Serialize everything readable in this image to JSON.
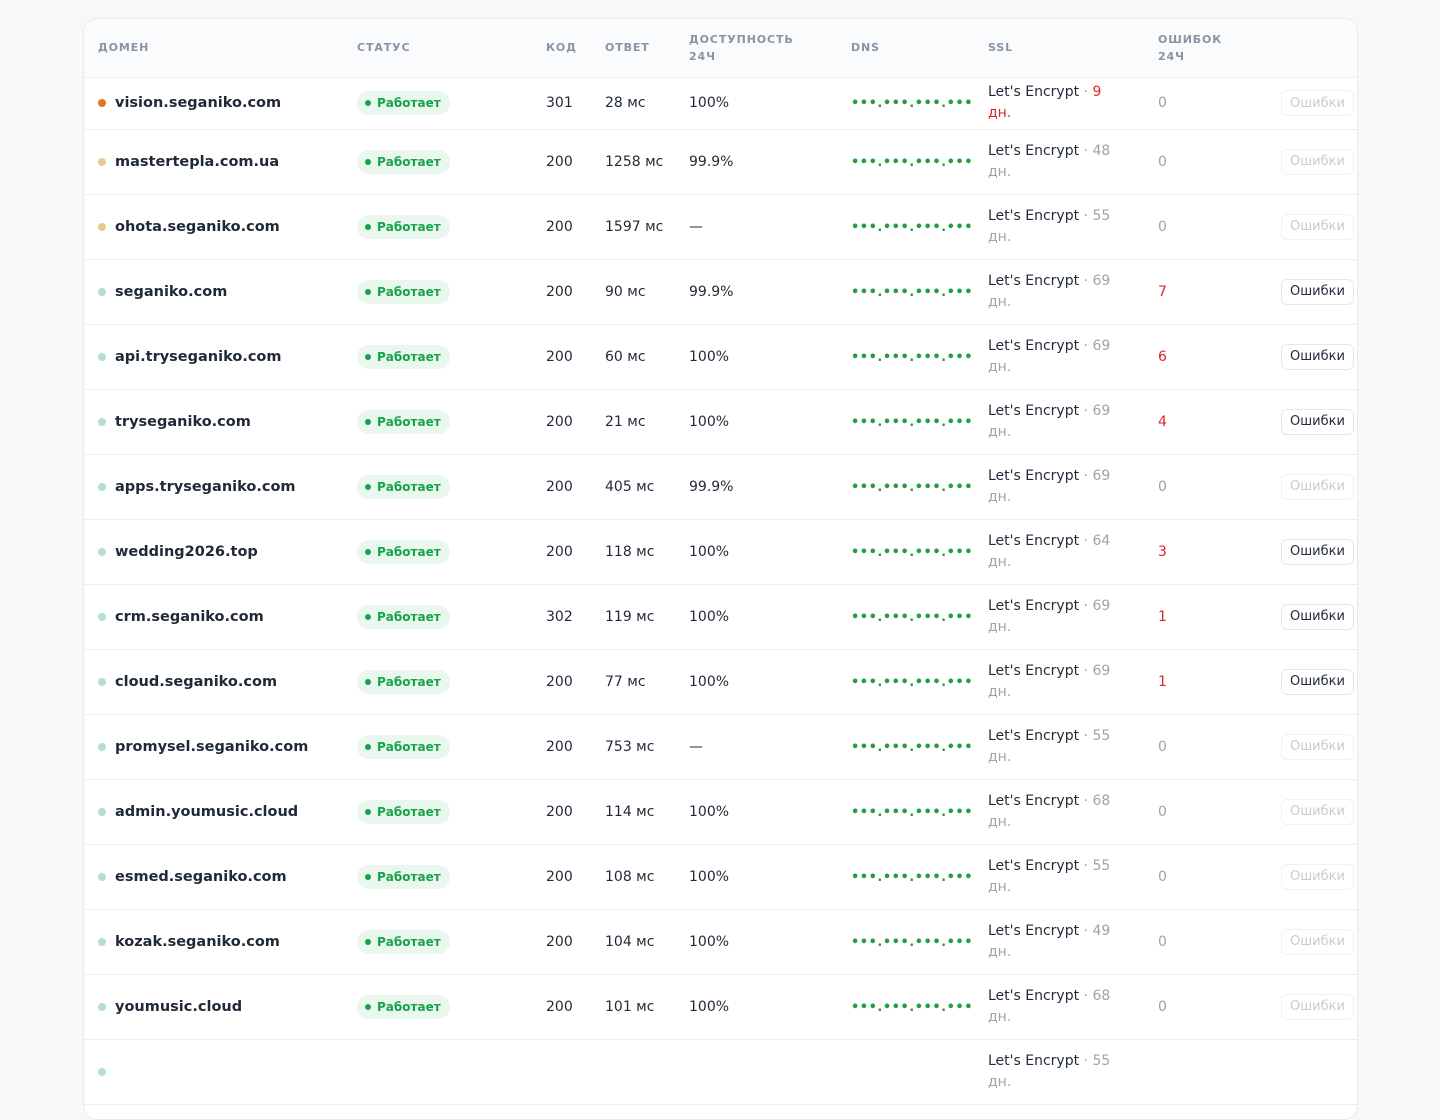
{
  "table": {
    "headers": {
      "domain": "ДОМЕН",
      "status": "СТАТУС",
      "code": "КОД",
      "response": "ОТВЕТ",
      "availability": [
        "ДОСТУПНОСТЬ",
        "24Ч"
      ],
      "dns": "DNS",
      "ssl": "SSL",
      "errors": [
        "ОШИБОК",
        "24Ч"
      ]
    },
    "status_label": "Работает",
    "errors_button": "Ошибки",
    "dns_mask": "•••.•••.•••.•••",
    "colors": {
      "ok": "#16a34a",
      "error": "#dc2626",
      "dot_orange": "#e8741a",
      "dot_tan": "#e8c98e",
      "dot_green": "#b5e0c6"
    },
    "rows": [
      {
        "domain": "vision.seganiko.com",
        "dot": "orange",
        "code": "301",
        "response": "28 мс",
        "availability": "100%",
        "ssl_issuer": "Let's Encrypt",
        "ssl_days": "9 дн.",
        "ssl_warn": true,
        "errors": "0",
        "errors_active": false
      },
      {
        "domain": "mastertepla.com.ua",
        "dot": "tan",
        "code": "200",
        "response": "1258 мс",
        "availability": "99.9%",
        "ssl_issuer": "Let's Encrypt",
        "ssl_days": "48 дн.",
        "ssl_warn": false,
        "errors": "0",
        "errors_active": false
      },
      {
        "domain": "ohota.seganiko.com",
        "dot": "tan",
        "code": "200",
        "response": "1597 мс",
        "availability": "—",
        "ssl_issuer": "Let's Encrypt",
        "ssl_days": "55 дн.",
        "ssl_warn": false,
        "errors": "0",
        "errors_active": false
      },
      {
        "domain": "seganiko.com",
        "dot": "green",
        "code": "200",
        "response": "90 мс",
        "availability": "99.9%",
        "ssl_issuer": "Let's Encrypt",
        "ssl_days": "69 дн.",
        "ssl_warn": false,
        "errors": "7",
        "errors_active": true
      },
      {
        "domain": "api.tryseganiko.com",
        "dot": "green",
        "code": "200",
        "response": "60 мс",
        "availability": "100%",
        "ssl_issuer": "Let's Encrypt",
        "ssl_days": "69 дн.",
        "ssl_warn": false,
        "errors": "6",
        "errors_active": true
      },
      {
        "domain": "tryseganiko.com",
        "dot": "green",
        "code": "200",
        "response": "21 мс",
        "availability": "100%",
        "ssl_issuer": "Let's Encrypt",
        "ssl_days": "69 дн.",
        "ssl_warn": false,
        "errors": "4",
        "errors_active": true
      },
      {
        "domain": "apps.tryseganiko.com",
        "dot": "green",
        "code": "200",
        "response": "405 мс",
        "availability": "99.9%",
        "ssl_issuer": "Let's Encrypt",
        "ssl_days": "69 дн.",
        "ssl_warn": false,
        "errors": "0",
        "errors_active": false
      },
      {
        "domain": "wedding2026.top",
        "dot": "green",
        "code": "200",
        "response": "118 мс",
        "availability": "100%",
        "ssl_issuer": "Let's Encrypt",
        "ssl_days": "64 дн.",
        "ssl_warn": false,
        "errors": "3",
        "errors_active": true
      },
      {
        "domain": "crm.seganiko.com",
        "dot": "green",
        "code": "302",
        "response": "119 мс",
        "availability": "100%",
        "ssl_issuer": "Let's Encrypt",
        "ssl_days": "69 дн.",
        "ssl_warn": false,
        "errors": "1",
        "errors_active": true
      },
      {
        "domain": "cloud.seganiko.com",
        "dot": "green",
        "code": "200",
        "response": "77 мс",
        "availability": "100%",
        "ssl_issuer": "Let's Encrypt",
        "ssl_days": "69 дн.",
        "ssl_warn": false,
        "errors": "1",
        "errors_active": true
      },
      {
        "domain": "promysel.seganiko.com",
        "dot": "green",
        "code": "200",
        "response": "753 мс",
        "availability": "—",
        "ssl_issuer": "Let's Encrypt",
        "ssl_days": "55 дн.",
        "ssl_warn": false,
        "errors": "0",
        "errors_active": false
      },
      {
        "domain": "admin.youmusic.cloud",
        "dot": "green",
        "code": "200",
        "response": "114 мс",
        "availability": "100%",
        "ssl_issuer": "Let's Encrypt",
        "ssl_days": "68 дн.",
        "ssl_warn": false,
        "errors": "0",
        "errors_active": false
      },
      {
        "domain": "esmed.seganiko.com",
        "dot": "green",
        "code": "200",
        "response": "108 мс",
        "availability": "100%",
        "ssl_issuer": "Let's Encrypt",
        "ssl_days": "55 дн.",
        "ssl_warn": false,
        "errors": "0",
        "errors_active": false
      },
      {
        "domain": "kozak.seganiko.com",
        "dot": "green",
        "code": "200",
        "response": "104 мс",
        "availability": "100%",
        "ssl_issuer": "Let's Encrypt",
        "ssl_days": "49 дн.",
        "ssl_warn": false,
        "errors": "0",
        "errors_active": false
      },
      {
        "domain": "youmusic.cloud",
        "dot": "green",
        "code": "200",
        "response": "101 мс",
        "availability": "100%",
        "ssl_issuer": "Let's Encrypt",
        "ssl_days": "68 дн.",
        "ssl_warn": false,
        "errors": "0",
        "errors_active": false
      },
      {
        "domain": "",
        "dot": "green",
        "code": "",
        "response": "",
        "availability": "",
        "ssl_issuer": "Let's Encrypt",
        "ssl_days": "55 дн.",
        "ssl_warn": false,
        "errors": "",
        "errors_active": false
      }
    ]
  }
}
